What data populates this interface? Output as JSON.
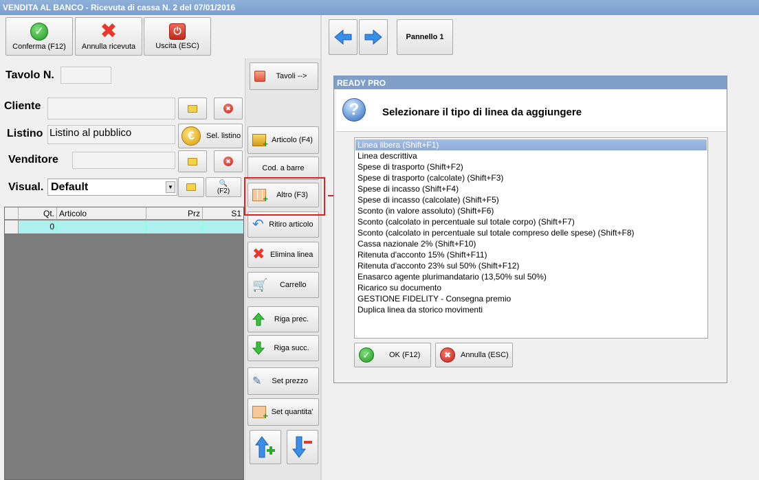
{
  "window": {
    "title": "VENDITA AL BANCO - Ricevuta di cassa N. 2 del 07/01/2016"
  },
  "toolbar": {
    "confirm_label": "Conferma (F12)",
    "cancel_label": "Annulla ricevuta",
    "exit_label": "Uscita (ESC)",
    "panel_label": "Pannello 1"
  },
  "form": {
    "tavolo_label": "Tavolo N.",
    "tavolo_value": "",
    "cliente_label": "Cliente",
    "cliente_value": "",
    "listino_label": "Listino",
    "listino_value": "Listino al pubblico",
    "listino_button": "Sel. listino",
    "venditore_label": "Venditore",
    "venditore_value": "",
    "visual_label": "Visual.",
    "visual_value": "Default",
    "f2_label": "(F2)"
  },
  "grid": {
    "columns": [
      "Qt.",
      "Articolo",
      "Prz",
      "S1"
    ],
    "rows": [
      {
        "qt": "0",
        "articolo": "",
        "prz": "",
        "s1": ""
      }
    ]
  },
  "side_buttons": {
    "tavoli": "Tavoli -->",
    "articolo": "Articolo (F4)",
    "cod_barre": "Cod. a barre",
    "altro": "Altro (F3)",
    "ritiro": "Ritiro articolo",
    "elimina": "Elimina linea",
    "carrello": "Carrello",
    "riga_prec": "Riga prec.",
    "riga_succ": "Riga succ.",
    "set_prezzo": "Set prezzo",
    "set_quantita": "Set quantita'"
  },
  "dialog": {
    "title": "READY PRO",
    "question": "Selezionare il tipo di linea da aggiungere",
    "items": [
      "Linea libera (Shift+F1)",
      "Linea descrittiva",
      "Spese di trasporto (Shift+F2)",
      "Spese di trasporto (calcolate) (Shift+F3)",
      "Spese di incasso (Shift+F4)",
      "Spese di incasso (calcolate) (Shift+F5)",
      "Sconto (in valore assoluto) (Shift+F6)",
      "Sconto (calcolato in percentuale sul totale corpo) (Shift+F7)",
      "Sconto (calcolato in percentuale sul totale compreso delle spese) (Shift+F8)",
      "Cassa nazionale 2% (Shift+F10)",
      "Ritenuta d'acconto 15% (Shift+F11)",
      "Ritenuta d'acconto 23% sul 50% (Shift+F12)",
      "Enasarco agente plurimandatario (13,50% sul 50%)",
      "Ricarico su documento",
      "GESTIONE FIDELITY - Consegna premio",
      "Duplica linea da storico movimenti"
    ],
    "selected_index": 0,
    "ok_label": "OK (F12)",
    "cancel_label": "Annulla (ESC)"
  },
  "colors": {
    "accent": "#7f9fc8",
    "highlight": "#e02020",
    "grid_row": "#aef0f0"
  }
}
